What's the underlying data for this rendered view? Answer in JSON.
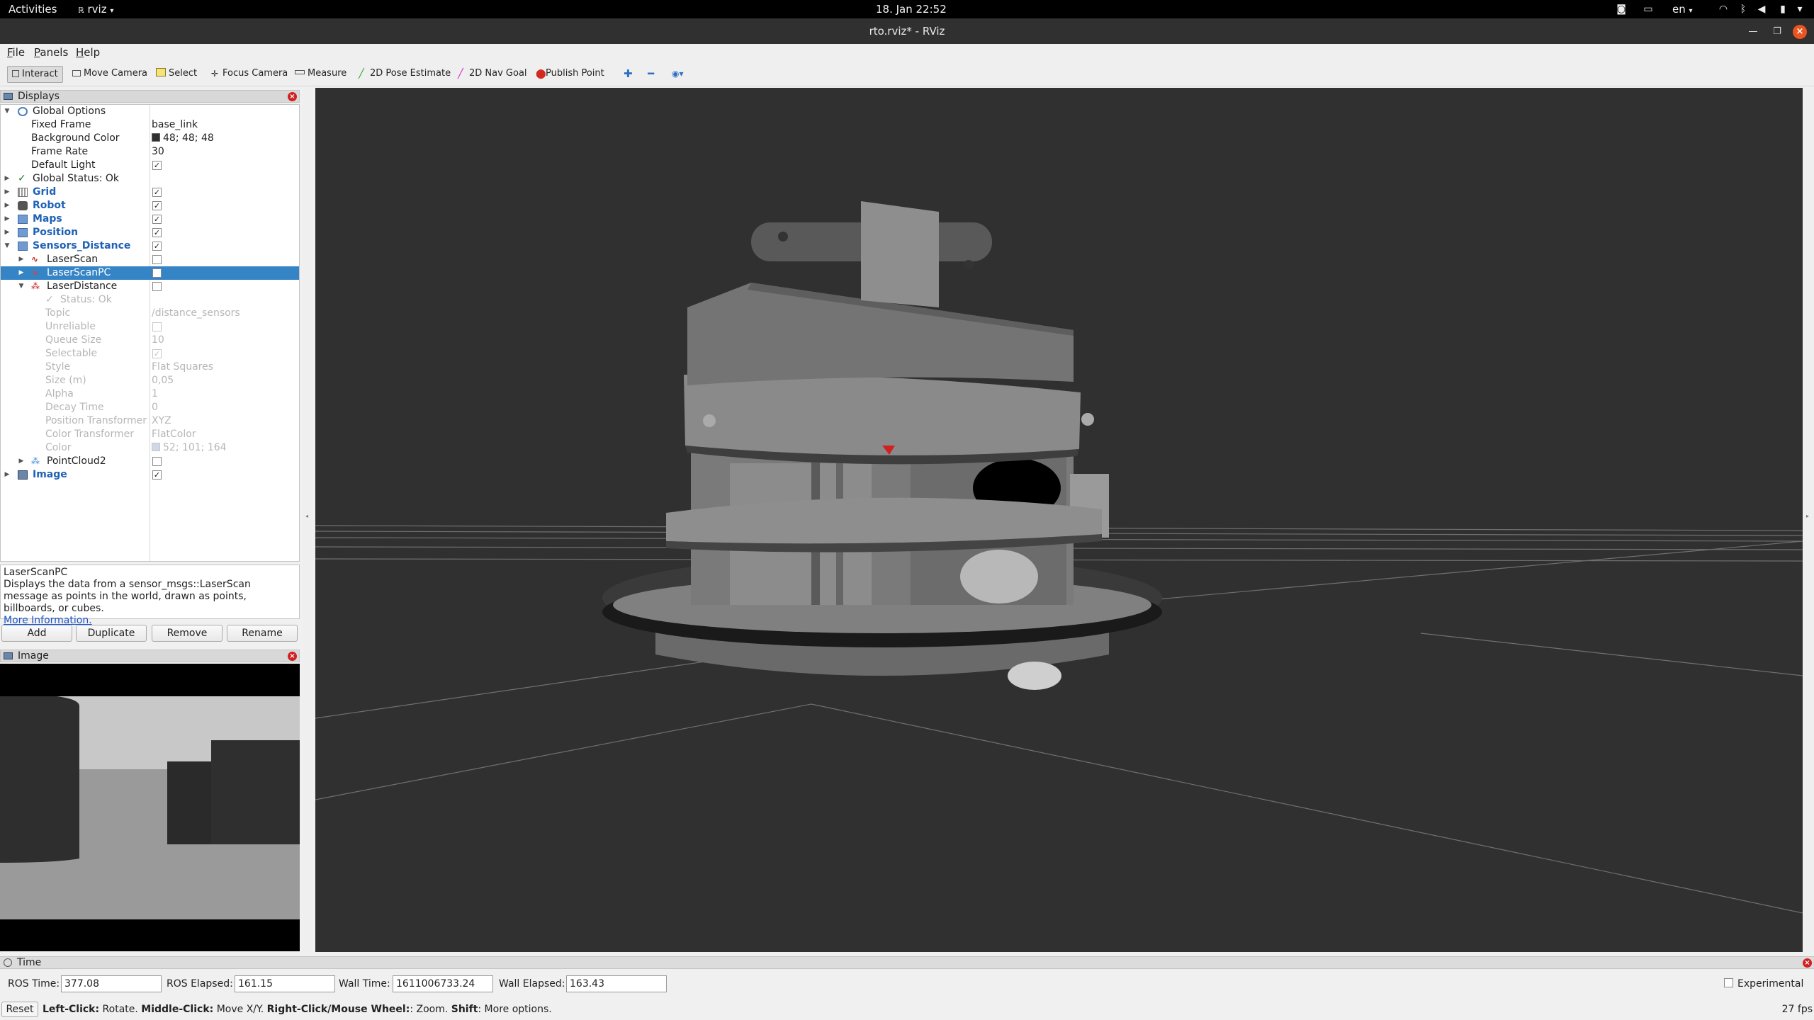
{
  "topbar": {
    "activities": "Activities",
    "app_name": "rviz",
    "datetime": "18. Jan  22:52",
    "lang": "en"
  },
  "window": {
    "title": "rto.rviz* - RViz"
  },
  "menu": {
    "file": "File",
    "panels": "Panels",
    "help": "Help"
  },
  "toolbar": {
    "interact": "Interact",
    "move_camera": "Move Camera",
    "select": "Select",
    "focus_camera": "Focus Camera",
    "measure": "Measure",
    "pose_estimate": "2D Pose Estimate",
    "nav_goal": "2D Nav Goal",
    "publish_point": "Publish Point"
  },
  "displays": {
    "title": "Displays",
    "global_options": "Global Options",
    "fixed_frame_label": "Fixed Frame",
    "fixed_frame_value": "base_link",
    "bg_color_label": "Background Color",
    "bg_color_value": "48; 48; 48",
    "frame_rate_label": "Frame Rate",
    "frame_rate_value": "30",
    "default_light_label": "Default Light",
    "global_status": "Global Status: Ok",
    "grid": "Grid",
    "robot": "Robot",
    "maps": "Maps",
    "position": "Position",
    "sensors_distance": "Sensors_Distance",
    "laserscan": "LaserScan",
    "laserscanpc": "LaserScanPC",
    "laserdistance": "LaserDistance",
    "status_ok": "Status: Ok",
    "topic_label": "Topic",
    "topic_value": "/distance_sensors",
    "unreliable_label": "Unreliable",
    "queue_size_label": "Queue Size",
    "queue_size_value": "10",
    "selectable_label": "Selectable",
    "style_label": "Style",
    "style_value": "Flat Squares",
    "size_label": "Size (m)",
    "size_value": "0,05",
    "alpha_label": "Alpha",
    "alpha_value": "1",
    "decay_label": "Decay Time",
    "decay_value": "0",
    "pos_transformer_label": "Position Transformer",
    "pos_transformer_value": "XYZ",
    "color_transformer_label": "Color Transformer",
    "color_transformer_value": "FlatColor",
    "color_label": "Color",
    "color_value": "52; 101; 164",
    "pointcloud2": "PointCloud2",
    "image": "Image"
  },
  "description": {
    "title": "LaserScanPC",
    "text": "Displays the data from a sensor_msgs::LaserScan message as points in the world, drawn as points, billboards, or cubes.",
    "link": "More Information."
  },
  "buttons": {
    "add": "Add",
    "duplicate": "Duplicate",
    "remove": "Remove",
    "rename": "Rename"
  },
  "image_panel": {
    "title": "Image"
  },
  "time": {
    "title": "Time",
    "ros_time_label": "ROS Time:",
    "ros_time_value": "377.08",
    "ros_elapsed_label": "ROS Elapsed:",
    "ros_elapsed_value": "161.15",
    "wall_time_label": "Wall Time:",
    "wall_time_value": "1611006733.24",
    "wall_elapsed_label": "Wall Elapsed:",
    "wall_elapsed_value": "163.43",
    "experimental": "Experimental"
  },
  "status": {
    "reset": "Reset",
    "left_click": "Left-Click:",
    "left_click_desc": " Rotate. ",
    "middle_click": "Middle-Click:",
    "middle_click_desc": " Move X/Y. ",
    "right_click": "Right-Click/Mouse Wheel:",
    "right_click_desc": ": Zoom. ",
    "shift": "Shift",
    "shift_desc": ": More options.",
    "fps": "27 fps"
  },
  "colors": {
    "view_background": "#303030",
    "selection": "#3584c6",
    "display_group_text": "#1f62b5",
    "close_button": "#d21f1f",
    "laser_color": "#3465a4"
  }
}
